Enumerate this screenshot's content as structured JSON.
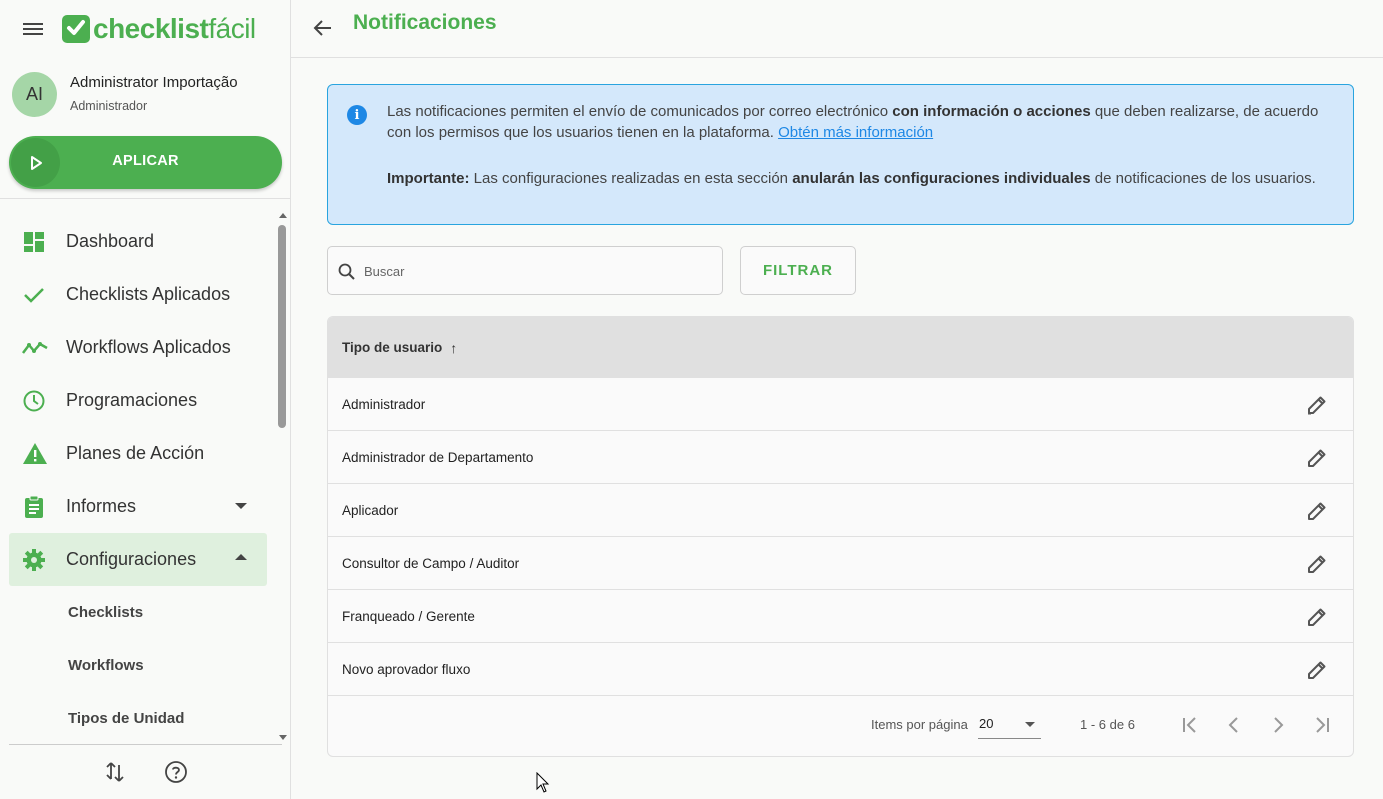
{
  "app": {
    "logo_prefix": "checklist",
    "logo_suffix": "fácil",
    "brand_color": "#4caf50"
  },
  "user": {
    "initials": "AI",
    "name": "Administrator Importação",
    "role": "Administrador"
  },
  "apply_button": {
    "label": "APLICAR"
  },
  "nav": {
    "items": [
      {
        "label": "Dashboard",
        "icon": "dashboard-icon"
      },
      {
        "label": "Checklists Aplicados",
        "icon": "check-icon"
      },
      {
        "label": "Workflows Aplicados",
        "icon": "trend-icon"
      },
      {
        "label": "Programaciones",
        "icon": "clock-icon"
      },
      {
        "label": "Planes de Acción",
        "icon": "warning-icon"
      },
      {
        "label": "Informes",
        "icon": "clipboard-icon"
      },
      {
        "label": "Configuraciones",
        "icon": "gear-icon"
      }
    ],
    "sub_items": [
      {
        "label": "Checklists"
      },
      {
        "label": "Workflows"
      },
      {
        "label": "Tipos de Unidad"
      }
    ]
  },
  "header": {
    "title": "Notificaciones"
  },
  "info": {
    "p1_a": "Las notificaciones permiten el envío de comunicados por correo electrónico ",
    "p1_b": "con información o acciones",
    "p1_c": " que deben realizarse, de acuerdo con los permisos que los usuarios tienen en la plataforma. ",
    "link": "Obtén más información",
    "p2_a": "Importante:",
    "p2_b": " Las configuraciones realizadas en esta sección ",
    "p2_c": "anularán las configuraciones individuales",
    "p2_d": " de notificaciones de los usuarios."
  },
  "search": {
    "placeholder": "Buscar",
    "value": ""
  },
  "filter_button": {
    "label": "FILTRAR"
  },
  "table": {
    "column": "Tipo de usuario",
    "sort_arrow": "↑",
    "rows": [
      "Administrador",
      "Administrador de Departamento",
      "Aplicador",
      "Consultor de Campo / Auditor",
      "Franqueado / Gerente",
      "Novo aprovador fluxo"
    ]
  },
  "pagination": {
    "items_per_page_label": "Items por página",
    "items_per_page": "20",
    "range": "1 - 6 de 6"
  }
}
